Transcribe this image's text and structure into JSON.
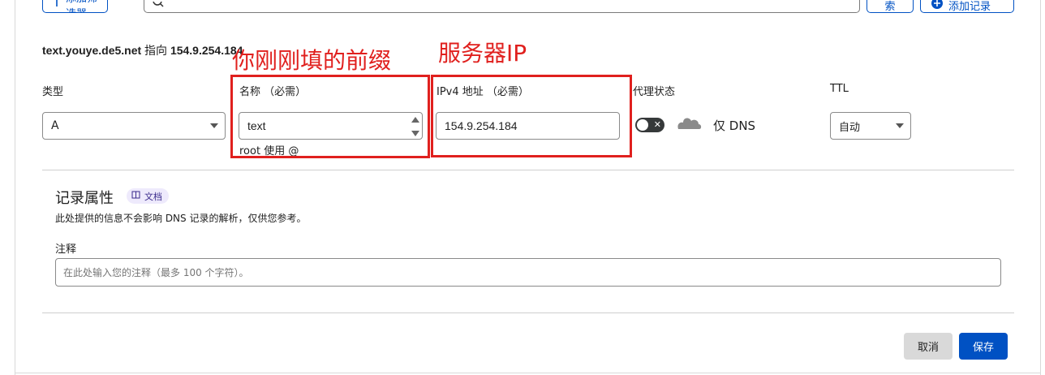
{
  "toolbar": {
    "add_filter_label": "添加筛选器",
    "search_button_label": "索",
    "add_record_label": "添加记录"
  },
  "record_summary": {
    "name": "text.youye.de5.net",
    "points_to": "指向",
    "ip": "154.9.254.184"
  },
  "form": {
    "type_label": "类型",
    "type_value": "A",
    "name_label": "名称 （必需）",
    "name_value": "text",
    "name_hint": "root 使用 @",
    "ipv4_label": "IPv4 地址 （必需）",
    "ipv4_value": "154.9.254.184",
    "proxy_label": "代理状态",
    "proxy_status_text": "仅 DNS",
    "ttl_label": "TTL",
    "ttl_value": "自动"
  },
  "annotations": {
    "name_note": "你刚刚填的前缀",
    "ip_note": "服务器IP"
  },
  "properties": {
    "title": "记录属性",
    "doc_badge": "文档",
    "description": "此处提供的信息不会影响 DNS 记录的解析，仅供您参考。",
    "comment_label": "注释",
    "comment_placeholder": "在此处输入您的注释（最多 100 个字符）。"
  },
  "actions": {
    "cancel_label": "取消",
    "save_label": "保存"
  },
  "colors": {
    "accent": "#0051c3",
    "annotation_red": "#e0201e",
    "badge_bg": "#eeeafc"
  }
}
